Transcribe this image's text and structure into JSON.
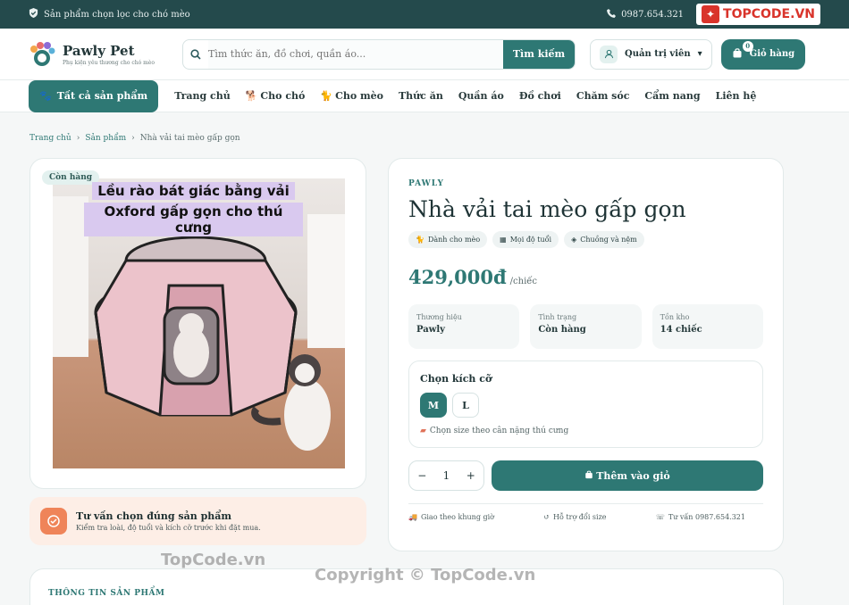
{
  "topbar": {
    "promo": "Sản phẩm chọn lọc cho chó mèo",
    "phone": "0987.654.321",
    "watermark_logo": "TOPCODE.VN"
  },
  "header": {
    "brand_name": "Pawly Pet",
    "brand_tagline": "Phụ kiện yêu thương cho chó mèo",
    "search_placeholder": "Tìm thức ăn, đồ chơi, quần áo...",
    "search_button": "Tìm kiếm",
    "account_label": "Quản trị viên",
    "cart_label": "Giỏ hàng",
    "cart_count": "0"
  },
  "nav": {
    "all_products": "Tất cả sản phẩm",
    "items": [
      "Trang chủ",
      "Cho chó",
      "Cho mèo",
      "Thức ăn",
      "Quần áo",
      "Đồ chơi",
      "Chăm sóc",
      "Cẩm nang",
      "Liên hệ"
    ]
  },
  "breadcrumb": [
    "Trang chủ",
    "Sản phẩm",
    "Nhà vải tai mèo gấp gọn"
  ],
  "gallery": {
    "stock_badge": "Còn hàng",
    "caption_line1": "Lều rào bát giác bằng vải",
    "caption_line2": "Oxford gấp gọn cho thú cưng"
  },
  "advice": {
    "title": "Tư vấn chọn đúng sản phẩm",
    "text": "Kiểm tra loài, độ tuổi và kích cỡ trước khi đặt mua."
  },
  "product": {
    "brand": "PAWLY",
    "name": "Nhà vải tai mèo gấp gọn",
    "tags": [
      "Dành cho mèo",
      "Mọi độ tuổi",
      "Chuồng và nệm"
    ],
    "price": "429,000đ",
    "unit": "/chiếc",
    "stats": [
      {
        "key": "Thương hiệu",
        "value": "Pawly"
      },
      {
        "key": "Tình trạng",
        "value": "Còn hàng"
      },
      {
        "key": "Tồn kho",
        "value": "14 chiếc"
      }
    ],
    "size_label": "Chọn kích cỡ",
    "sizes": [
      "M",
      "L"
    ],
    "selected_size": "M",
    "size_hint": "Chọn size theo cân nặng thú cưng",
    "quantity": "1",
    "minus": "−",
    "plus": "+",
    "add_to_cart": "Thêm vào giỏ",
    "perks": [
      "Giao theo khung giờ",
      "Hỗ trợ đổi size",
      "Tư vấn 0987.654.321"
    ]
  },
  "details": {
    "heading": "THÔNG TIN SẢN PHẨM"
  },
  "watermarks": {
    "w1": "TopCode.vn",
    "w2": "Copyright © TopCode.vn"
  },
  "colors": {
    "primary": "#2e7874",
    "topbar": "#244a4c",
    "accent_orange": "#ef8459",
    "advice_bg": "#fdeee6"
  }
}
